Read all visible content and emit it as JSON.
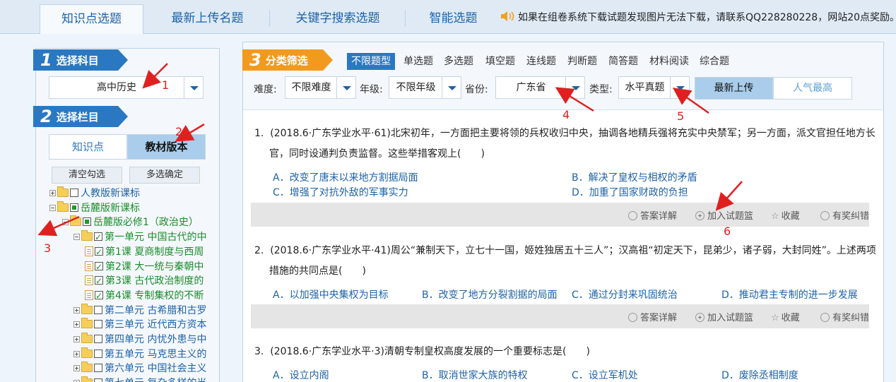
{
  "tabs": [
    {
      "label": "知识点选题",
      "active": true
    },
    {
      "label": "最新上传名题",
      "active": false
    },
    {
      "label": "关键字搜索选题",
      "active": false
    },
    {
      "label": "智能选题",
      "active": false
    }
  ],
  "notice": "如果在组卷系统下载试题发现图片无法下载，请联系QQ228280228，网站20点奖励。",
  "left": {
    "step1": {
      "num": "1",
      "title": "选择科目"
    },
    "subject": "高中历史",
    "step2": {
      "num": "2",
      "title": "选择栏目"
    },
    "mode_tabs": [
      "知识点",
      "教材版本"
    ],
    "clear_btn": "清空勾选",
    "confirm_btn": "多选确定",
    "tree": [
      {
        "label": "人教版新课标",
        "level": 0,
        "state": "plus",
        "checked": "none"
      },
      {
        "label": "岳麓版新课标",
        "level": 0,
        "state": "minus",
        "checked": "partial"
      },
      {
        "label": "岳麓版必修1（政治史）",
        "level": 1,
        "state": "minus",
        "checked": "partial"
      },
      {
        "label": "第一单元 中国古代的中",
        "level": 2,
        "state": "minus",
        "checked": "checked"
      },
      {
        "label": "第1课 夏商制度与西周",
        "level": 3,
        "state": "leaf",
        "checked": "checked"
      },
      {
        "label": "第2课 大一统与秦朝中",
        "level": 3,
        "state": "leaf",
        "checked": "checked"
      },
      {
        "label": "第3课 古代政治制度的",
        "level": 3,
        "state": "leaf",
        "checked": "checked"
      },
      {
        "label": "第4课 专制集权的不断",
        "level": 3,
        "state": "leaf",
        "checked": "checked"
      },
      {
        "label": "第二单元 古希腊和古罗",
        "level": 2,
        "state": "plus",
        "checked": "none"
      },
      {
        "label": "第三单元 近代西方资本",
        "level": 2,
        "state": "plus",
        "checked": "none"
      },
      {
        "label": "第四单元 内忧外患与中",
        "level": 2,
        "state": "plus",
        "checked": "none"
      },
      {
        "label": "第五单元 马克思主义的",
        "level": 2,
        "state": "plus",
        "checked": "none"
      },
      {
        "label": "第六单元 中国社会主义",
        "level": 2,
        "state": "plus",
        "checked": "none"
      },
      {
        "label": "第七单元 复杂多样的当",
        "level": 2,
        "state": "plus",
        "checked": "none"
      }
    ]
  },
  "right": {
    "step3": {
      "num": "3",
      "title": "分类筛选"
    },
    "qtypes": [
      "不限题型",
      "单选题",
      "多选题",
      "填空题",
      "连线题",
      "判断题",
      "简答题",
      "材料阅读",
      "综合题"
    ],
    "filters": {
      "difficulty_label": "难度:",
      "difficulty": "不限难度",
      "grade_label": "年级:",
      "grade": "不限年级",
      "province_label": "省份:",
      "province": "广东省",
      "type_label": "类型:",
      "type": "水平真题"
    },
    "sort": [
      "最新上传",
      "人气最高"
    ],
    "actions": [
      "答案详解",
      "加入试题篮",
      "收藏",
      "有奖纠错"
    ],
    "questions": [
      {
        "num": "1.",
        "line1": "(2018.6·广东学业水平·61)北宋初年，一方面把主要将领的兵权收归中央，抽调各地精兵强将充实中央禁军；另一方面，派文官担任地方长",
        "line2": "官，同时设通判负责监督。这些举措客观上(　　)",
        "options": [
          "A．改变了唐末以来地方割据局面",
          "B．解决了皇权与相权的矛盾",
          "C．增强了对抗外敌的军事实力",
          "D．加重了国家财政的负担"
        ]
      },
      {
        "num": "2.",
        "line1": "(2018.6·广东学业水平·41)周公“兼制天下，立七十一国，姬姓独居五十三人”；汉高祖“初定天下，昆弟少，诸子弱，大封同姓”。上述两项",
        "line2": "措施的共同点是(　　)",
        "options": [
          "A．以加强中央集权为目标",
          "B．改变了地方分裂割据的局面",
          "C．通过分封来巩固统治",
          "D．推动君主专制的进一步发展"
        ]
      },
      {
        "num": "3.",
        "line1": "(2018.6·广东学业水平·3)清朝专制皇权高度发展的一个重要标志是(　　)",
        "line2": "",
        "options": [
          "A．设立内阁",
          "B．取消世家大族的特权",
          "C．设立军机处",
          "D．废除丞相制度"
        ]
      }
    ]
  },
  "annotations": [
    "1",
    "2",
    "3",
    "4",
    "5",
    "6"
  ],
  "colors": {
    "accent": "#2a78c2",
    "step3": "#f29a1d",
    "link": "#1e62a8",
    "annotation": "#e02020"
  }
}
